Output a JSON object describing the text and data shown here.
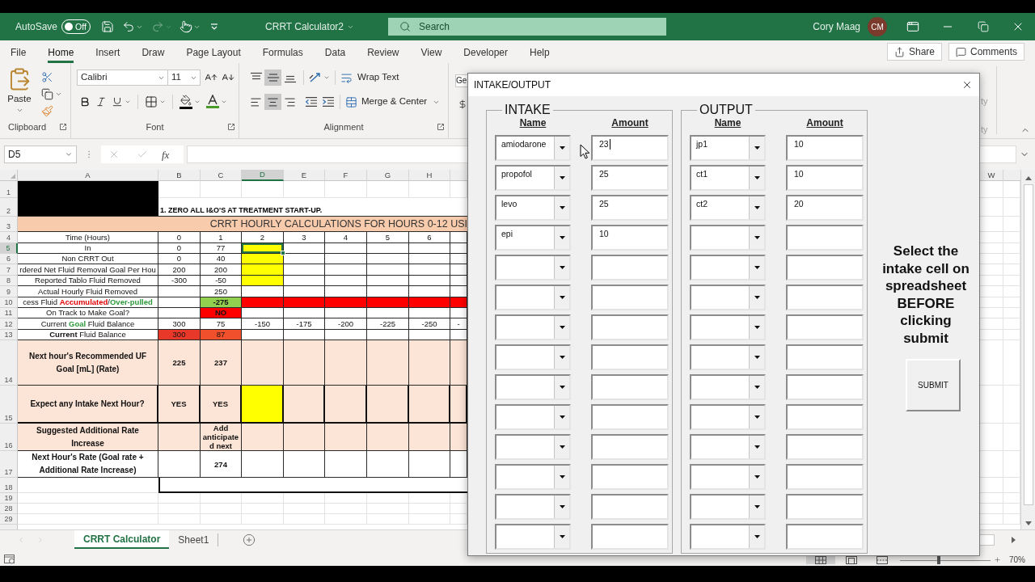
{
  "title_bar": {
    "autosave_label": "AutoSave",
    "autosave_toggle": {
      "on": false,
      "label": "Off"
    },
    "redo": {
      "disabled": true
    },
    "document_title": "CRRT Calculator2",
    "search": {
      "placeholder": "Search"
    },
    "user": {
      "name": "Cory Maag",
      "initials": "CM"
    }
  },
  "menu_tabs": [
    {
      "label": "File",
      "selected": false
    },
    {
      "label": "Home",
      "selected": true
    },
    {
      "label": "Insert",
      "selected": false
    },
    {
      "label": "Draw",
      "selected": false
    },
    {
      "label": "Page Layout",
      "selected": false
    },
    {
      "label": "Formulas",
      "selected": false
    },
    {
      "label": "Data",
      "selected": false
    },
    {
      "label": "Review",
      "selected": false
    },
    {
      "label": "View",
      "selected": false
    },
    {
      "label": "Developer",
      "selected": false
    },
    {
      "label": "Help",
      "selected": false
    }
  ],
  "share_button": {
    "label": "Share"
  },
  "comments_button": {
    "label": "Comments"
  },
  "ribbon": {
    "clipboard": {
      "label": "Clipboard",
      "paste_label": "Paste"
    },
    "font": {
      "label": "Font",
      "font_name": "Calibri",
      "font_size": "11"
    },
    "alignment": {
      "label": "Alignment",
      "vertical_buttons": [
        {
          "selected": false
        },
        {
          "selected": true
        },
        {
          "selected": false
        }
      ],
      "horizontal_buttons": [
        {
          "selected": false
        },
        {
          "selected": true
        },
        {
          "selected": false
        }
      ],
      "wrap_text": "Wrap Text",
      "merge_center": "Merge & Center"
    },
    "number": {
      "format": "Ge"
    },
    "hidden_group_fragments": [
      "ty",
      "ty"
    ]
  },
  "formula_bar": {
    "name_box": "D5",
    "editing": false,
    "function_label": "fx"
  },
  "sheet": {
    "columns": [
      {
        "label": "A",
        "selected": false
      },
      {
        "label": "B",
        "selected": false
      },
      {
        "label": "C",
        "selected": false
      },
      {
        "label": "D",
        "selected": true
      },
      {
        "label": "E",
        "selected": false
      },
      {
        "label": "F",
        "selected": false
      },
      {
        "label": "G",
        "selected": false
      },
      {
        "label": "H",
        "selected": false
      }
    ],
    "right_columns": [
      {
        "label": "W",
        "selected": false
      }
    ],
    "banner": {
      "row_headers": [
        {
          "label": "1",
          "selected": false
        },
        {
          "label": "2",
          "selected": false
        }
      ],
      "instruction": "1. ZERO ALL I&O'S AT TREATMENT START-UP."
    },
    "title_row": {
      "header": {
        "label": "3",
        "selected": false
      },
      "title": "CRRT HOURLY CALCULATIONS FOR HOURS 0-12 USI"
    },
    "rows": [
      {
        "header": "4",
        "selected": false,
        "kind": "data",
        "cells": [
          {
            "text": "Time (Hours)",
            "selected": false
          },
          {
            "text": "0",
            "selected": false
          },
          {
            "text": "1",
            "selected": false
          },
          {
            "text": "2",
            "selected": false
          },
          {
            "text": "3",
            "selected": false
          },
          {
            "text": "4",
            "selected": false
          },
          {
            "text": "5",
            "selected": false
          },
          {
            "text": "6",
            "selected": false
          },
          {
            "selected": false
          }
        ]
      },
      {
        "header": "5",
        "selected": true,
        "kind": "data",
        "cells": [
          {
            "text": "In",
            "selected": false
          },
          {
            "text": "0",
            "selected": false
          },
          {
            "text": "77",
            "selected": false
          },
          {
            "color": "#ffff00",
            "selected": true
          },
          {
            "selected": false
          },
          {
            "selected": false
          },
          {
            "selected": false
          },
          {
            "selected": false
          },
          {
            "selected": false
          }
        ]
      },
      {
        "header": "6",
        "selected": false,
        "kind": "data",
        "cells": [
          {
            "text": "Non CRRT Out",
            "selected": false
          },
          {
            "text": "0",
            "selected": false
          },
          {
            "text": "40",
            "selected": false
          },
          {
            "color": "#ffff00",
            "selected": false
          },
          {
            "selected": false
          },
          {
            "selected": false
          },
          {
            "selected": false
          },
          {
            "selected": false
          },
          {
            "selected": false
          }
        ]
      },
      {
        "header": "7",
        "selected": false,
        "kind": "data",
        "cells": [
          {
            "text": "rdered Net Fluid Removal Goal Per Hou",
            "selected": false
          },
          {
            "text": "200",
            "selected": false
          },
          {
            "text": "200",
            "selected": false
          },
          {
            "color": "#ffff00",
            "selected": false
          },
          {
            "selected": false
          },
          {
            "selected": false
          },
          {
            "selected": false
          },
          {
            "selected": false
          },
          {
            "selected": false
          }
        ]
      },
      {
        "header": "8",
        "selected": false,
        "kind": "data",
        "cells": [
          {
            "text": "Reported Tablo Fluid Removed",
            "selected": false
          },
          {
            "text": "-300",
            "selected": false
          },
          {
            "text": "-50",
            "selected": false
          },
          {
            "color": "#ffff00",
            "selected": false
          },
          {
            "selected": false
          },
          {
            "selected": false
          },
          {
            "selected": false
          },
          {
            "selected": false
          },
          {
            "selected": false
          }
        ]
      },
      {
        "header": "9",
        "selected": false,
        "kind": "data",
        "cells": [
          {
            "text": "Actual Hourly Fluid Removed",
            "selected": false
          },
          {
            "selected": false
          },
          {
            "text": "250",
            "selected": false
          },
          {
            "selected": false
          },
          {
            "selected": false
          },
          {
            "selected": false
          },
          {
            "selected": false
          },
          {
            "selected": false
          },
          {
            "selected": false
          }
        ]
      },
      {
        "header": "10",
        "selected": false,
        "kind": "data",
        "cells": [
          {
            "segments": [
              {
                "text": "cess Fluid ",
                "kind": "plain"
              },
              {
                "text": "Accumulated",
                "kind": "alert"
              },
              {
                "text": "/",
                "kind": "plain"
              },
              {
                "text": "Over-pulled",
                "kind": "good"
              }
            ],
            "selected": false
          },
          {
            "selected": false
          },
          {
            "text": "-275",
            "bold": true,
            "color": "#92d050",
            "selected": false
          },
          {
            "color": "#ff0000",
            "selected": false
          },
          {
            "color": "#ff0000",
            "selected": false
          },
          {
            "color": "#ff0000",
            "selected": false
          },
          {
            "color": "#ff0000",
            "selected": false
          },
          {
            "color": "#ff0000",
            "selected": false
          },
          {
            "color": "#ff0000",
            "selected": false
          }
        ]
      },
      {
        "header": "11",
        "selected": false,
        "kind": "data",
        "cells": [
          {
            "text": "On Track to Make Goal?",
            "selected": false
          },
          {
            "selected": false
          },
          {
            "text": "NO",
            "bold": true,
            "color": "#ff0000",
            "selected": false
          },
          {
            "selected": false
          },
          {
            "selected": false
          },
          {
            "selected": false
          },
          {
            "selected": false
          },
          {
            "selected": false
          },
          {
            "selected": false
          }
        ]
      },
      {
        "header": "12",
        "selected": false,
        "kind": "data",
        "cells": [
          {
            "segments": [
              {
                "text": "Current ",
                "kind": "plain"
              },
              {
                "text": "Goal",
                "kind": "good"
              },
              {
                "text": " Fluid Balance",
                "kind": "plain"
              }
            ],
            "selected": false
          },
          {
            "text": "300",
            "selected": false
          },
          {
            "text": "75",
            "selected": false
          },
          {
            "text": "-150",
            "selected": false
          },
          {
            "text": "-175",
            "selected": false
          },
          {
            "text": "-200",
            "selected": false
          },
          {
            "text": "-225",
            "selected": false
          },
          {
            "text": "-250",
            "selected": false
          },
          {
            "text": "-",
            "selected": false
          }
        ]
      },
      {
        "header": "13",
        "selected": false,
        "kind": "data",
        "cells": [
          {
            "segments": [
              {
                "text": "Current",
                "kind": "strong"
              },
              {
                "text": " Fluid Balance",
                "kind": "plain"
              }
            ],
            "selected": false
          },
          {
            "text": "300",
            "color": "#e8382a",
            "selected": false
          },
          {
            "text": "87",
            "color": "#f0502c",
            "selected": false
          },
          {
            "selected": false
          },
          {
            "selected": false
          },
          {
            "selected": false
          },
          {
            "selected": false
          },
          {
            "selected": false
          },
          {
            "selected": false
          }
        ]
      },
      {
        "header": "14",
        "selected": false,
        "kind": "summary",
        "cells": [
          {
            "text": "Next hour's Recommended UF Goal [mL] (Rate)",
            "bold": true,
            "color": "#fce4d6",
            "selected": false
          },
          {
            "text": "225",
            "bold": true,
            "color": "#fce4d6",
            "selected": false
          },
          {
            "text": "237",
            "bold": true,
            "color": "#fce4d6",
            "selected": false
          },
          {
            "color": "#fce4d6",
            "selected": false
          },
          {
            "color": "#fce4d6",
            "selected": false
          },
          {
            "color": "#fce4d6",
            "selected": false
          },
          {
            "color": "#fce4d6",
            "selected": false
          },
          {
            "color": "#fce4d6",
            "selected": false
          },
          {
            "color": "#fce4d6",
            "selected": false
          }
        ]
      },
      {
        "header": "15",
        "selected": false,
        "kind": "emphasis",
        "cells": [
          {
            "text": "Expect any Intake Next Hour?",
            "bold": true,
            "color": "#fce4d6",
            "selected": false
          },
          {
            "text": "YES",
            "bold": true,
            "color": "#fce4d6",
            "selected": false
          },
          {
            "text": "YES",
            "bold": true,
            "color": "#fce4d6",
            "selected": false
          },
          {
            "color": "#ffff00",
            "selected": false
          },
          {
            "color": "#fce4d6",
            "selected": false
          },
          {
            "color": "#fce4d6",
            "selected": false
          },
          {
            "color": "#fce4d6",
            "selected": false
          },
          {
            "color": "#fce4d6",
            "selected": false
          },
          {
            "color": "#fce4d6",
            "selected": false
          }
        ]
      },
      {
        "header": "16",
        "selected": false,
        "kind": "summary",
        "cells": [
          {
            "text": "Suggested Additional Rate Increase",
            "bold": true,
            "color": "#fce4d6",
            "selected": false
          },
          {
            "color": "#fce4d6",
            "selected": false
          },
          {
            "text": "Add anticipated next",
            "bold": true,
            "color": "#fce4d6",
            "selected": false
          },
          {
            "color": "#fce4d6",
            "selected": false
          },
          {
            "color": "#fce4d6",
            "selected": false
          },
          {
            "color": "#fce4d6",
            "selected": false
          },
          {
            "color": "#fce4d6",
            "selected": false
          },
          {
            "color": "#fce4d6",
            "selected": false
          },
          {
            "color": "#fce4d6",
            "selected": false
          }
        ]
      },
      {
        "header": "17",
        "selected": false,
        "kind": "summary",
        "cells": [
          {
            "text": "Next Hour's Rate (Goal rate + Additional Rate Increase)",
            "bold": true,
            "selected": false
          },
          {
            "selected": false
          },
          {
            "text": "274",
            "bold": true,
            "selected": false
          },
          {
            "selected": false
          },
          {
            "selected": false
          },
          {
            "selected": false
          },
          {
            "selected": false
          },
          {
            "selected": false
          },
          {
            "selected": false
          }
        ]
      },
      {
        "header": "18",
        "selected": false,
        "kind": "boxed"
      },
      {
        "header": "19",
        "selected": false,
        "kind": "blank"
      },
      {
        "header": "28",
        "selected": false,
        "kind": "blank"
      },
      {
        "header": "29",
        "selected": false,
        "kind": "blank"
      }
    ]
  },
  "sheet_nav": {
    "disabled": true
  },
  "sheet_tabs": [
    {
      "label": "CRRT Calculator",
      "selected": true
    },
    {
      "label": "Sheet1",
      "selected": false
    }
  ],
  "status_bar": {
    "views": [
      {
        "selected": true
      },
      {
        "selected": false
      },
      {
        "selected": false
      }
    ],
    "zoom": {
      "level": 0.43,
      "label": "70%"
    }
  },
  "dialog": {
    "title": "INTAKE/OUTPUT",
    "sections": [
      {
        "title": "INTAKE",
        "name_heading": "Name",
        "amount_heading": "Amount",
        "rows": [
          {
            "name": "amiodarone",
            "amount": "23",
            "focused": true
          },
          {
            "name": "propofol",
            "amount": "25",
            "focused": false
          },
          {
            "name": "levo",
            "amount": "25",
            "focused": false
          },
          {
            "name": "epi",
            "amount": "10",
            "focused": false
          },
          {
            "focused": false
          },
          {
            "focused": false
          },
          {
            "focused": false
          },
          {
            "focused": false
          },
          {
            "focused": false
          },
          {
            "focused": false
          },
          {
            "focused": false
          },
          {
            "focused": false
          },
          {
            "focused": false
          },
          {
            "focused": false
          }
        ]
      },
      {
        "title": "OUTPUT",
        "name_heading": "Name",
        "amount_heading": "Amount",
        "rows": [
          {
            "name": "jp1",
            "amount": "10",
            "focused": false
          },
          {
            "name": "ct1",
            "amount": "10",
            "focused": false
          },
          {
            "name": "ct2",
            "amount": "20",
            "focused": false
          },
          {
            "focused": false
          },
          {
            "focused": false
          },
          {
            "focused": false
          },
          {
            "focused": false
          },
          {
            "focused": false
          },
          {
            "focused": false
          },
          {
            "focused": false
          },
          {
            "focused": false
          },
          {
            "focused": false
          },
          {
            "focused": false
          },
          {
            "focused": false
          }
        ]
      }
    ],
    "instructions": "Select the intake cell on spreadsheet BEFORE clicking submit",
    "submit_button": "SUBMIT"
  }
}
